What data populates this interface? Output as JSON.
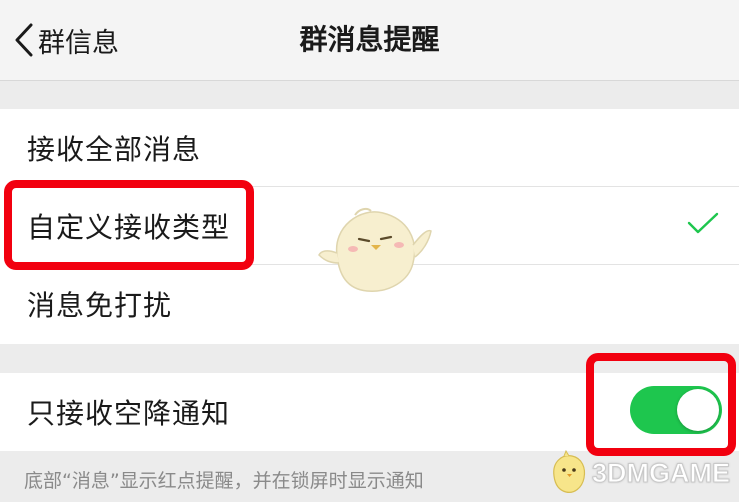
{
  "nav": {
    "back_label": "群信息",
    "title": "群消息提醒"
  },
  "options": [
    {
      "label": "接收全部消息",
      "selected": false
    },
    {
      "label": "自定义接收类型",
      "selected": true
    },
    {
      "label": "消息免打扰",
      "selected": false
    }
  ],
  "airdrop": {
    "label": "只接收空降通知",
    "enabled": true,
    "note": "底部“消息”显示红点提醒，并在锁屏时显示通知"
  },
  "watermark": {
    "text": "3DMGAME"
  },
  "colors": {
    "highlight": "#f2000f",
    "toggle_on": "#1ec64e",
    "check": "#1ec64e"
  }
}
